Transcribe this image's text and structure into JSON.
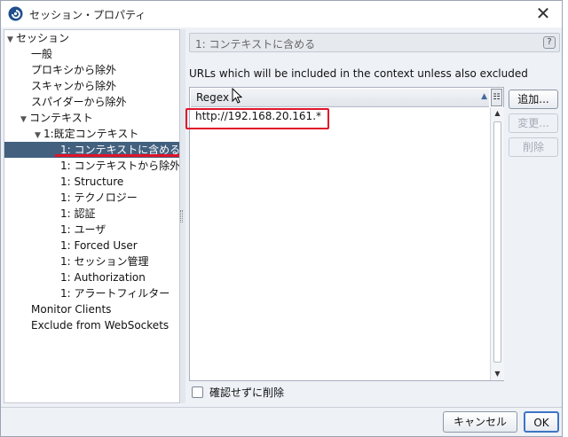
{
  "window": {
    "title": "セッション・プロパティ"
  },
  "tree": {
    "items": [
      {
        "label": "セッション",
        "arrow": "▼"
      },
      {
        "label": "一般"
      },
      {
        "label": "プロキシから除外"
      },
      {
        "label": "スキャンから除外"
      },
      {
        "label": "スパイダーから除外"
      },
      {
        "label": "コンテキスト",
        "arrow": "▼"
      },
      {
        "label": "1:既定コンテキスト",
        "arrow": "▼"
      },
      {
        "label": "1: コンテキストに含める",
        "selected": true
      },
      {
        "label": "1: コンテキストから除外"
      },
      {
        "label": "1: Structure"
      },
      {
        "label": "1: テクノロジー"
      },
      {
        "label": "1: 認証"
      },
      {
        "label": "1: ユーザ"
      },
      {
        "label": "1: Forced User"
      },
      {
        "label": "1: セッション管理"
      },
      {
        "label": "1: Authorization"
      },
      {
        "label": "1: アラートフィルター"
      },
      {
        "label": "Monitor Clients"
      },
      {
        "label": "Exclude from WebSockets"
      }
    ]
  },
  "panel": {
    "title": "1: コンテキストに含める",
    "description": "URLs which will be included in the context unless also excluded",
    "column_header": "Regex",
    "rows": [
      "http://192.168.20.161.*"
    ],
    "buttons": {
      "add": "追加...",
      "edit": "変更...",
      "delete": "削除"
    },
    "checkbox_label": "確認せずに削除"
  },
  "footer": {
    "cancel": "キャンセル",
    "ok": "OK"
  },
  "colors": {
    "selection": "#43607f",
    "highlight_red": "#e0142a",
    "ok_border": "#3d74c6"
  }
}
